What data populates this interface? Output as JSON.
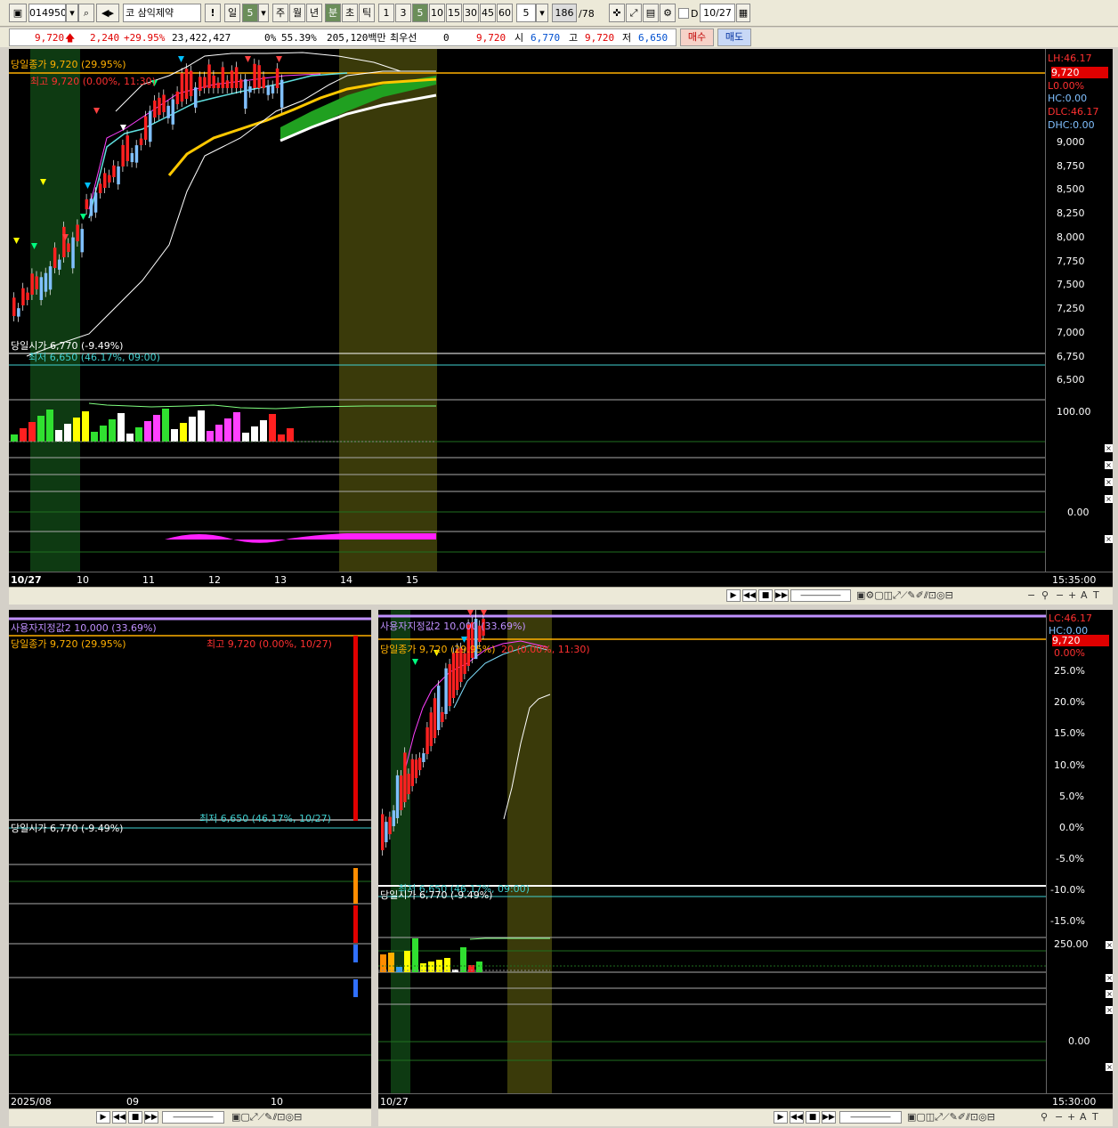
{
  "toolbar": {
    "code": "014950",
    "market": "코",
    "stock_name": "삼익제약",
    "alert": "!",
    "period_day": "일",
    "period_num": "5",
    "week": "주",
    "month": "월",
    "year": "년",
    "minute": "분",
    "second": "초",
    "tick": "틱",
    "intervals": [
      "1",
      "3",
      "5",
      "10",
      "15",
      "30",
      "45",
      "60"
    ],
    "interval_value": "5",
    "count": "186",
    "count_total": "/78",
    "d_label": "D",
    "date": "10/27"
  },
  "quote": {
    "price": "9,720",
    "change": "2,240",
    "change_pct": "+29.95%",
    "volume": "23,422,427",
    "zero_pct": "0%",
    "ratio": "55.39%",
    "amount": "205,120백만",
    "best": "최우선",
    "best_val": "0",
    "best_price": "9,720",
    "open_label": "시",
    "open": "6,770",
    "high_label": "고",
    "high": "9,720",
    "low_label": "저",
    "low": "6,650",
    "buy": "매수",
    "sell": "매도"
  },
  "top_chart": {
    "label_close": "당일종가 9,720 (29.95%)",
    "label_high": "최고 9,720 (0.00%, 11:30)",
    "label_open": "당일시가 6,770 (-9.49%)",
    "label_low": "최저 6,650 (46.17%, 09:00)",
    "right_lh": "LH:46.17",
    "right_price": "9,720",
    "right_l": "L0.00%",
    "right_hc": "HC:0.00",
    "right_dlc": "DLC:46.17",
    "right_dhc": "DHC:0.00",
    "yticks": [
      "9,000",
      "8,750",
      "8,500",
      "8,250",
      "8,000",
      "7,750",
      "7,500",
      "7,250",
      "7,000",
      "6,750",
      "6,500"
    ],
    "vol_tick": "100.00",
    "osc_tick": "0.00",
    "xticks": [
      "10/27",
      "10",
      "11",
      "12",
      "13",
      "14",
      "15"
    ],
    "time": "15:35:00"
  },
  "bottom_left": {
    "label_user": "사용자지정값2 10,000 (33.69%)",
    "label_close": "당일종가 9,720 (29.95%)",
    "label_high": "최고 9,720 (0.00%, 10/27)",
    "label_low": "최저 6,650 (46.17%, 10/27)",
    "label_open": "당일시가 6,770 (-9.49%)",
    "xticks": [
      "2025/08",
      "09",
      "10"
    ]
  },
  "bottom_right": {
    "label_user": "사용자지정값2 10,000 (33.69%)",
    "label_close": "당일종가 9,720 (29.95%)",
    "label_high": "20 (0.00%, 11:30)",
    "label_low": "최저 6,650 (46.17%, 09:00)",
    "label_open": "당일시가 6,770 (-9.49%)",
    "right_lc": "LC:46.17",
    "right_hc": "HC:0.00",
    "right_price": "9,720",
    "right_pct": "0.00%",
    "yticks": [
      "25.0%",
      "20.0%",
      "15.0%",
      "10.0%",
      "5.0%",
      "0.0%",
      "-5.0%",
      "-10.0%",
      "-15.0%"
    ],
    "vol_tick": "250.00",
    "osc_tick": "0.00",
    "xtick": "10/27",
    "time": "15:30:00"
  },
  "colors": {
    "up": "#ff2020",
    "down": "#80c0ff",
    "close_line": "#ffb000",
    "low_line": "#40d0d0",
    "green_zone": "#0e3a12",
    "olive_zone": "#3a3a0a",
    "user_line": "#c090ff"
  }
}
